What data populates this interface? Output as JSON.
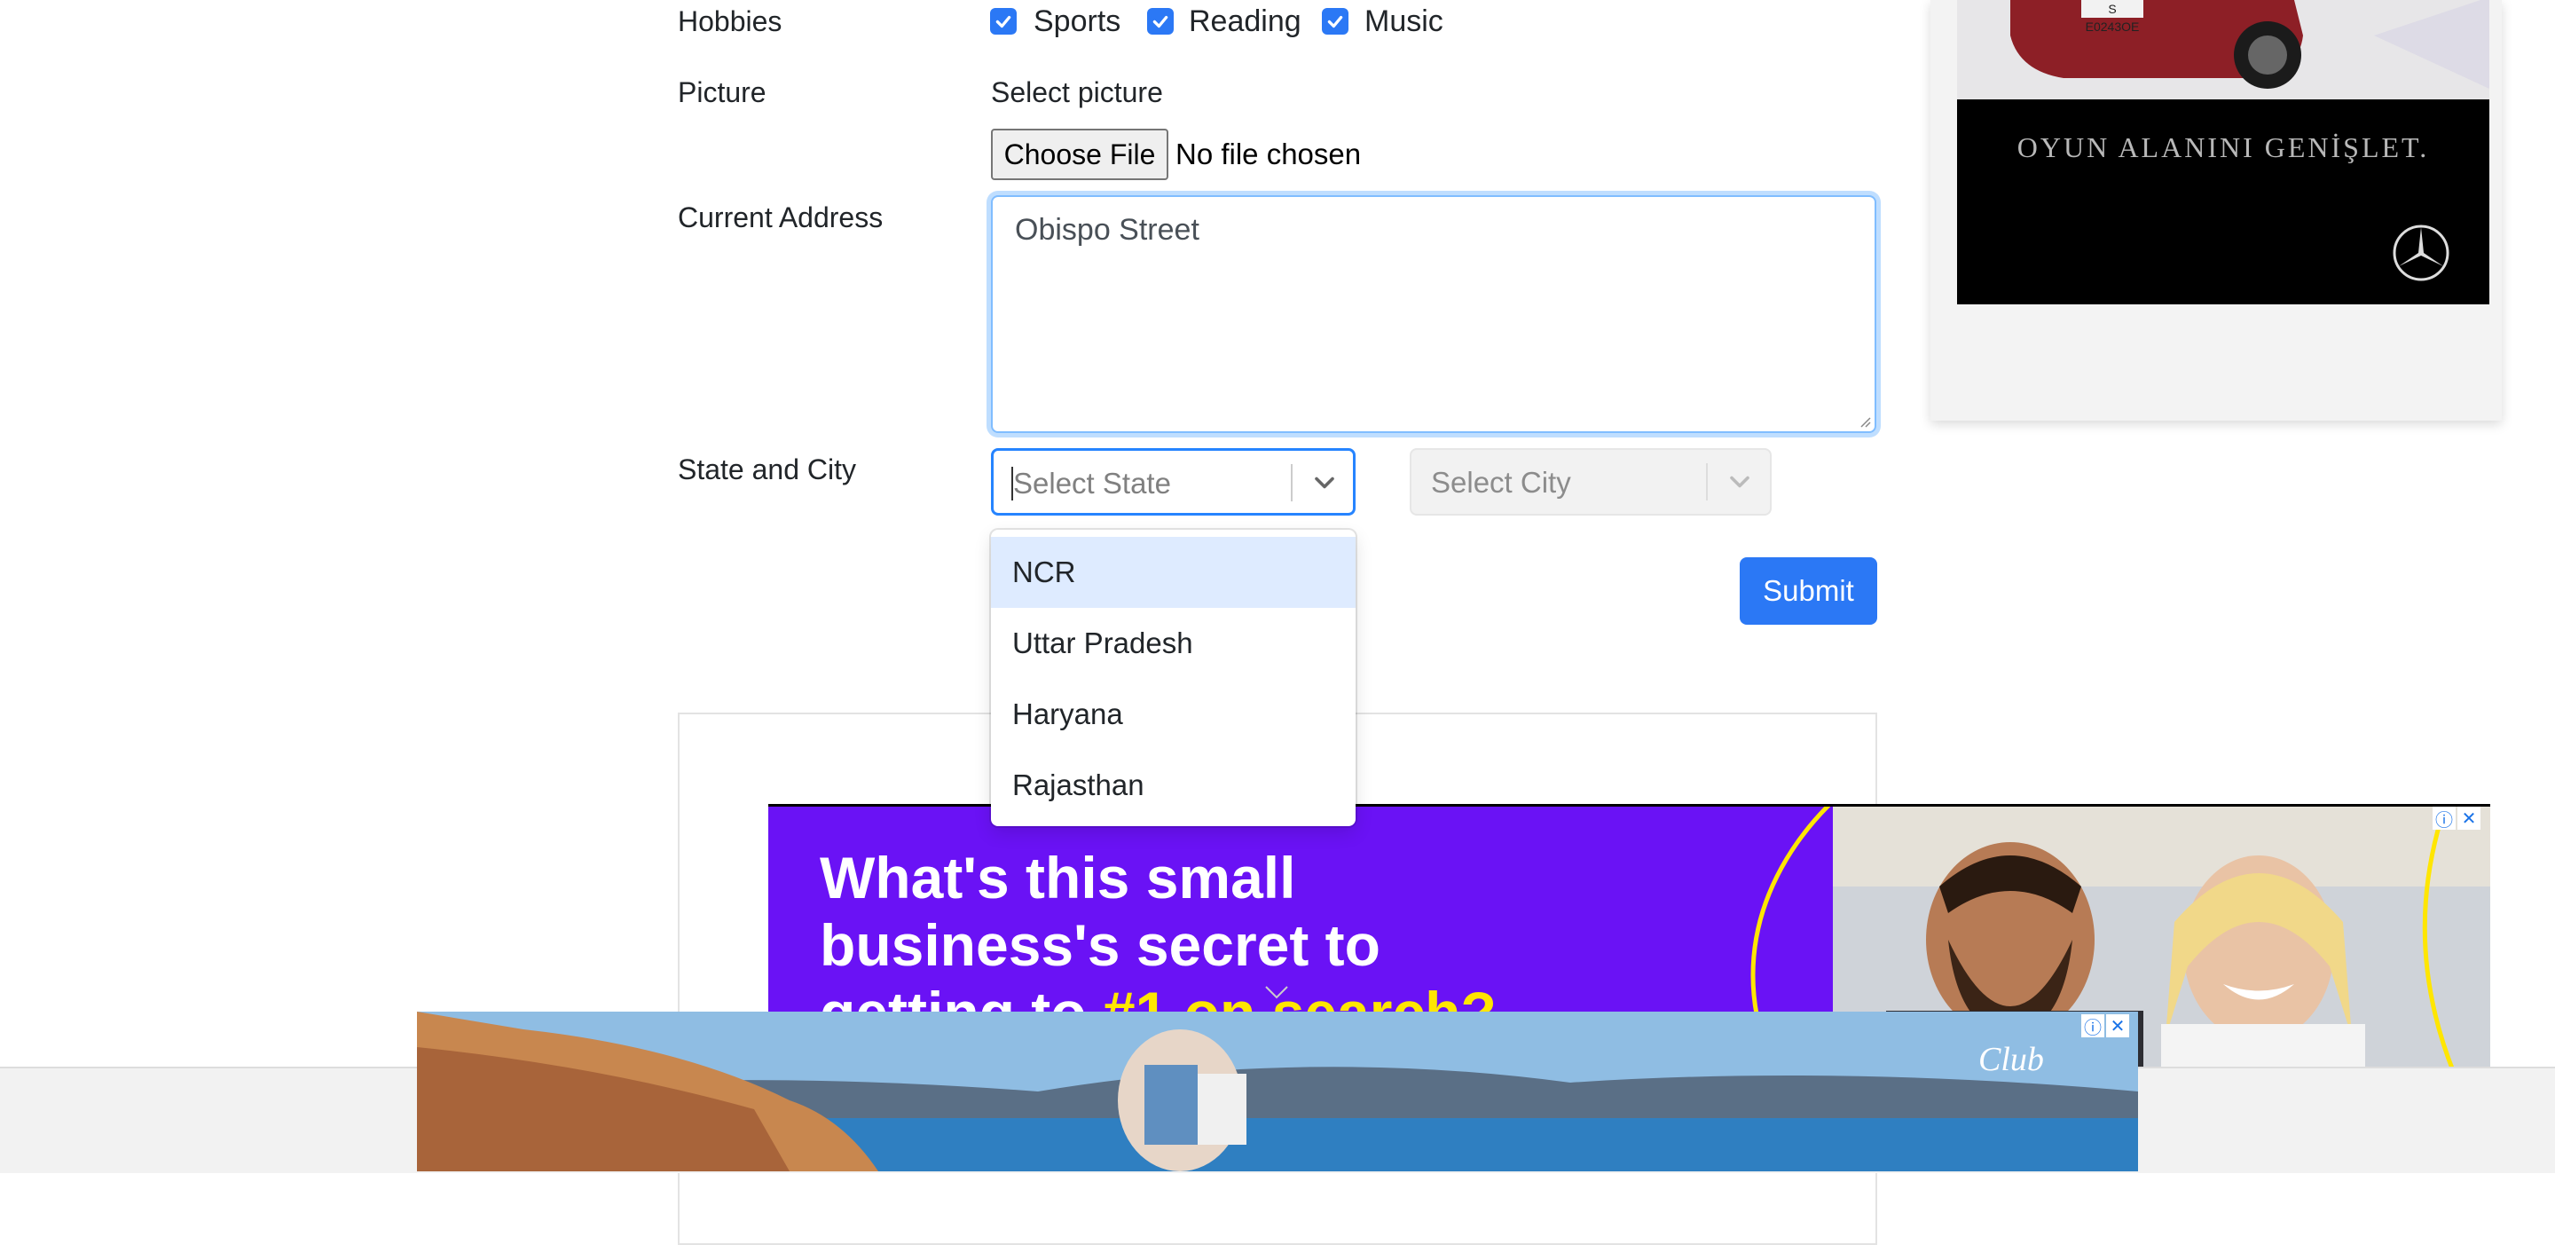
{
  "form": {
    "hobbies": {
      "label": "Hobbies",
      "options": [
        {
          "label": "Sports",
          "checked": true
        },
        {
          "label": "Reading",
          "checked": true
        },
        {
          "label": "Music",
          "checked": true
        }
      ]
    },
    "picture": {
      "label": "Picture",
      "helper": "Select picture",
      "button": "Choose File",
      "status": "No file chosen"
    },
    "address": {
      "label": "Current Address",
      "value": "Obispo Street"
    },
    "state_city": {
      "label": "State and City",
      "state_placeholder": "Select State",
      "city_placeholder": "Select City",
      "state_options": [
        "NCR",
        "Uttar Pradesh",
        "Haryana",
        "Rajasthan"
      ],
      "highlighted": "NCR"
    },
    "submit_label": "Submit"
  },
  "ads": {
    "side_ad_text": "OYUN ALANINI GENİŞLET.",
    "plate_text": "S E0243OE",
    "purple_headline_1": "What's this small",
    "purple_headline_2": "business's secret to",
    "purple_headline_3a": "getting to ",
    "purple_headline_3b": "#1 on search?",
    "bottom_logo": "Club"
  },
  "colors": {
    "accent": "#2b78f5",
    "purple_ad": "#6a12f5",
    "highlight_option": "#deebff"
  }
}
